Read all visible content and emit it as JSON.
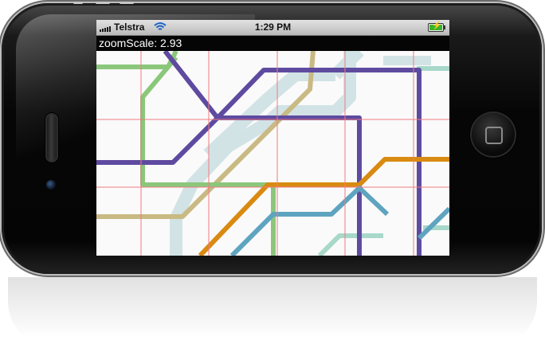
{
  "status_bar": {
    "carrier": "Telstra",
    "time": "1:29 PM",
    "battery_charging": true,
    "signal_bars": 5,
    "wifi_icon": "wifi-icon",
    "battery_icon": "battery-charging-icon"
  },
  "zoom_label": "zoomScale: 2.93",
  "zoom_scale": 2.93,
  "map": {
    "description_lines": [
      {
        "name": "purple-line",
        "color": "#5e4ba0"
      },
      {
        "name": "green-line",
        "color": "#8bc77b"
      },
      {
        "name": "tan-line",
        "color": "#c9b983"
      },
      {
        "name": "orange-line",
        "color": "#d98a11"
      },
      {
        "name": "blue-line",
        "color": "#5ea4c0"
      },
      {
        "name": "light-teal-line",
        "color": "#d2e3e6"
      },
      {
        "name": "mint-line",
        "color": "#a7d8c9"
      }
    ],
    "grid_color": "#f07a80"
  }
}
